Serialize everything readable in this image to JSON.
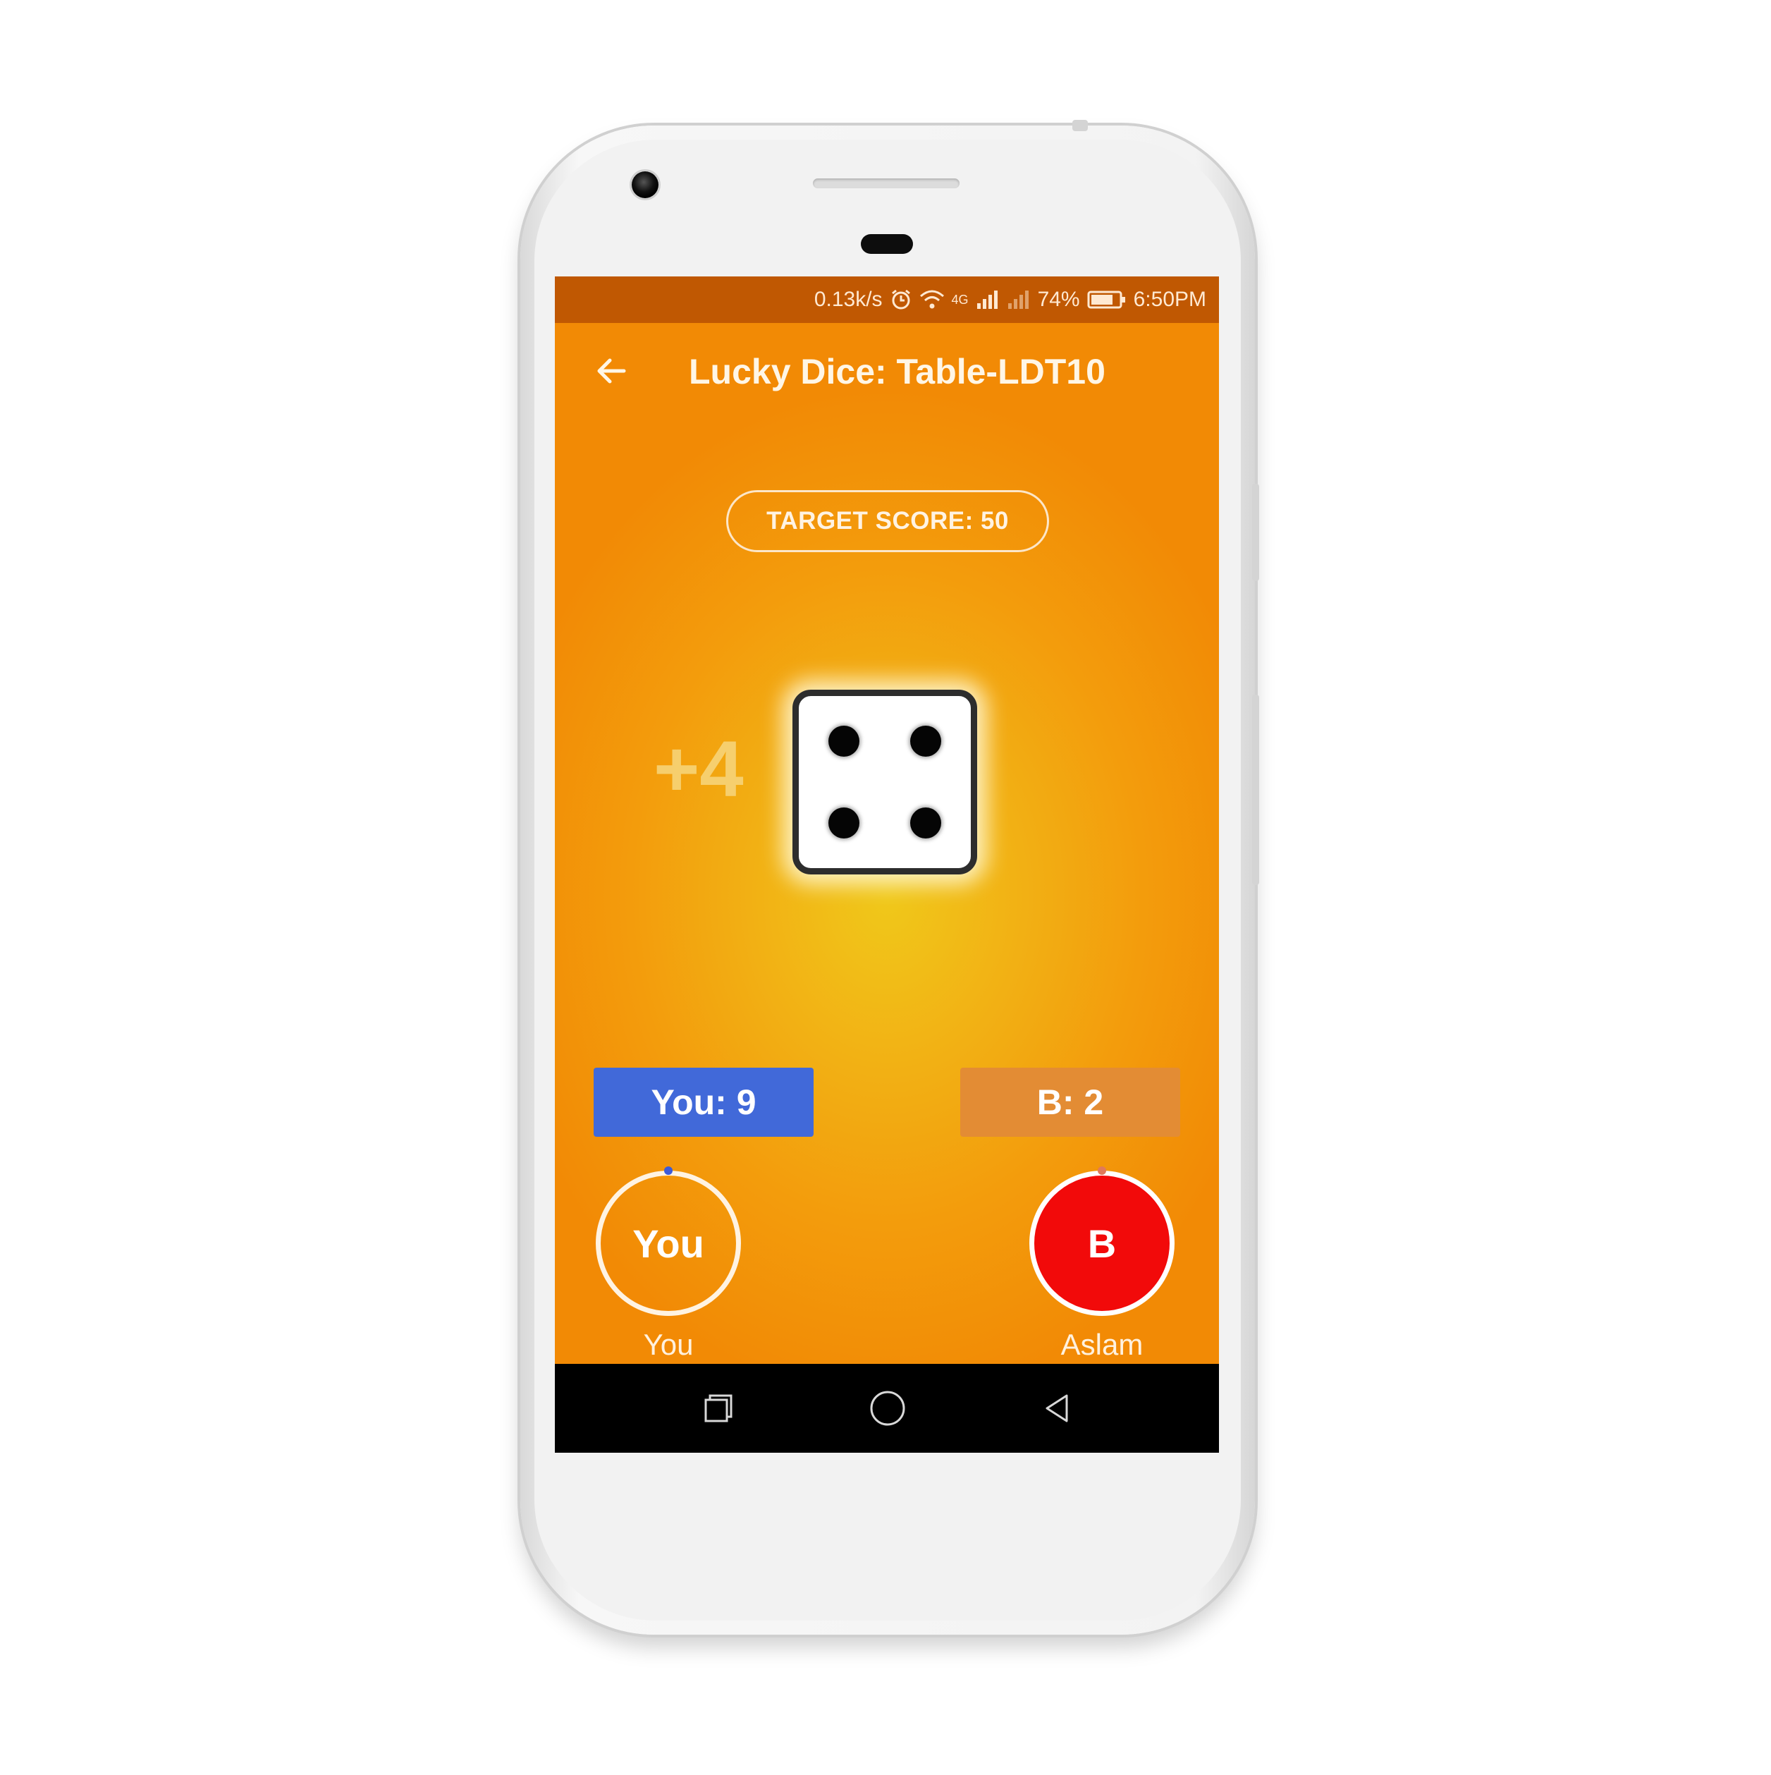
{
  "status_bar": {
    "speed": "0.13k/s",
    "network": "4G",
    "battery": "74%",
    "time": "6:50PM",
    "icons": [
      "alarm-icon",
      "wifi-icon",
      "signal-icon",
      "signal-weak-icon",
      "battery-icon"
    ]
  },
  "toolbar": {
    "title": "Lucky Dice: Table-LDT10",
    "back_icon": "arrow-left-icon"
  },
  "game": {
    "target_score": "TARGET SCORE: 50",
    "last_roll_delta": "+4",
    "die_face": 4
  },
  "scores": {
    "you": "You: 9",
    "opponent": "B: 2"
  },
  "players": {
    "you": {
      "avatar_label": "You",
      "name": "You",
      "ring_color": "#fff3e2",
      "dot_color": "#3d5bd8"
    },
    "opponent": {
      "avatar_label": "B",
      "name": "Aslam",
      "fill_color": "#f20a0a",
      "dot_color": "#e07a5a"
    }
  },
  "navigation": {
    "recents": "recents-icon",
    "home": "home-icon",
    "back": "back-triangle-icon"
  },
  "colors": {
    "status_bar": "#c05802",
    "background_outer": "#f28a05",
    "background_glow": "#f0c81a",
    "you_score_bg": "#4169d9",
    "opponent_score_bg": "#e38c34"
  }
}
